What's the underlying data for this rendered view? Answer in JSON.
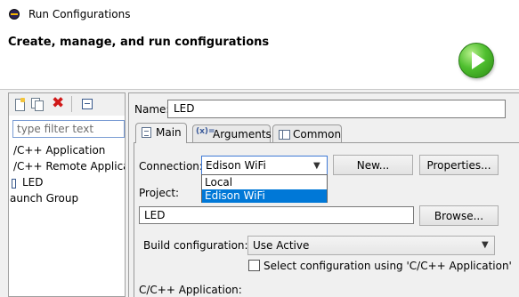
{
  "window": {
    "title": "Run Configurations"
  },
  "banner": {
    "title": "Create, manage, and run configurations"
  },
  "left": {
    "filter_placeholder": "type filter text",
    "tree": [
      "/C++ Application",
      "/C++ Remote Applicatio",
      "LED",
      "aunch Group"
    ]
  },
  "main": {
    "name_label": "Name:",
    "name_value": "LED",
    "tabs": [
      {
        "label": "Main",
        "icon": "main-tab-icon"
      },
      {
        "label": "Arguments",
        "icon": "arguments-icon"
      },
      {
        "label": "Common",
        "icon": "common-icon"
      }
    ],
    "connection": {
      "label": "Connection:",
      "selected": "Edison WiFi",
      "options": [
        "Local",
        "Edison WiFi"
      ],
      "new_label": "New...",
      "properties_label": "Properties..."
    },
    "project": {
      "label": "Project:",
      "value": "LED",
      "browse_label": "Browse..."
    },
    "build": {
      "label": "Build configuration:",
      "selected": "Use Active",
      "checkbox_label": "Select configuration using 'C/C++ Application'"
    },
    "app_label": "C/C++ Application:"
  }
}
